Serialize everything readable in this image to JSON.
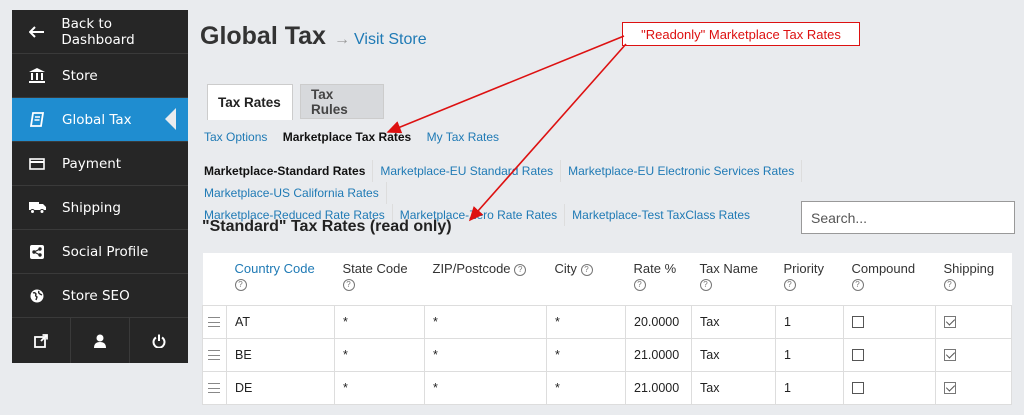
{
  "sidebar": {
    "items": [
      {
        "label": "Back to Dashboard",
        "icon": "arrow-left-icon"
      },
      {
        "label": "Store",
        "icon": "bank-icon"
      },
      {
        "label": "Global Tax",
        "icon": "book-icon"
      },
      {
        "label": "Payment",
        "icon": "credit-card-icon"
      },
      {
        "label": "Shipping",
        "icon": "truck-icon"
      },
      {
        "label": "Social Profile",
        "icon": "share-icon"
      },
      {
        "label": "Store SEO",
        "icon": "globe-icon"
      }
    ],
    "bottom_icons": [
      "external-link-icon",
      "user-icon",
      "power-icon"
    ],
    "accent": "#1f8dd0"
  },
  "header": {
    "title": "Global Tax",
    "arrow": "→",
    "visit_label": "Visit Store"
  },
  "tabs": [
    {
      "label": "Tax Rates"
    },
    {
      "label": "Tax Rules"
    }
  ],
  "sublinks": {
    "tax_options": "Tax Options",
    "marketplace_rates": "Marketplace Tax Rates",
    "my_rates": "My Tax Rates"
  },
  "rate_classes": [
    "Marketplace-Standard Rates",
    "Marketplace-EU Standard Rates",
    "Marketplace-EU Electronic Services Rates",
    "Marketplace-US California Rates",
    "Marketplace-Reduced Rate Rates",
    "Marketplace-Zero Rate Rates",
    "Marketplace-Test TaxClass Rates"
  ],
  "section_title": "\"Standard\" Tax Rates (read only)",
  "search": {
    "placeholder": "Search..."
  },
  "table": {
    "headers": [
      "Country Code",
      "State Code",
      "ZIP/Postcode",
      "City",
      "Rate %",
      "Tax Name",
      "Priority",
      "Compound",
      "Shipping"
    ],
    "help_glyph": "?",
    "rows": [
      {
        "country": "AT",
        "state": "*",
        "zip": "*",
        "city": "*",
        "rate": "20.0000",
        "name": "Tax",
        "priority": "1",
        "compound": false,
        "shipping": true
      },
      {
        "country": "BE",
        "state": "*",
        "zip": "*",
        "city": "*",
        "rate": "21.0000",
        "name": "Tax",
        "priority": "1",
        "compound": false,
        "shipping": true
      },
      {
        "country": "DE",
        "state": "*",
        "zip": "*",
        "city": "*",
        "rate": "21.0000",
        "name": "Tax",
        "priority": "1",
        "compound": false,
        "shipping": true
      }
    ]
  },
  "annotation": {
    "text": "\"Readonly\" Marketplace Tax Rates",
    "color": "#dd1111"
  }
}
